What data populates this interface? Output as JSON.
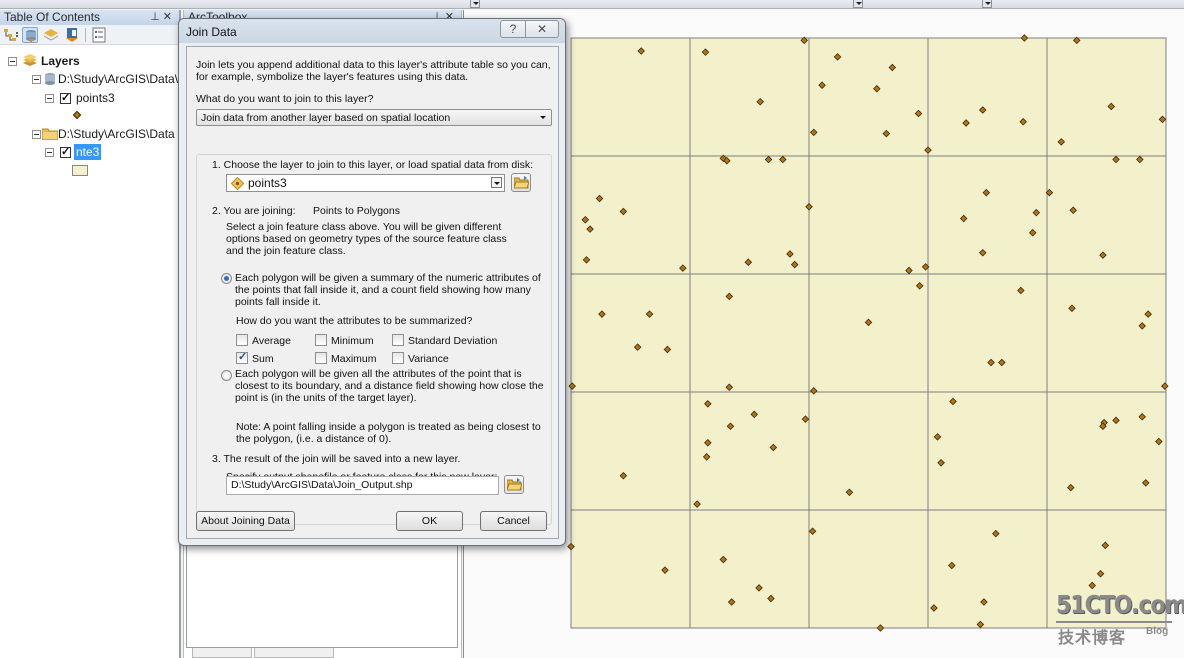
{
  "toolbar": {
    "dropdowns": [
      "toolbar-dropdown-1",
      "toolbar-dropdown-2",
      "toolbar-dropdown-3"
    ]
  },
  "toc": {
    "title": "Table Of Contents",
    "pin_icon": "pin-icon",
    "close_icon": "close-icon",
    "tools": [
      "list-by-drawing-order",
      "list-by-source",
      "list-by-visibility",
      "list-by-selection",
      "options"
    ],
    "tree": {
      "root_label": "Layers",
      "groups": [
        {
          "path": "D:\\Study\\ArcGIS\\Data\\",
          "icon": "database-icon",
          "layer": {
            "name": "points3",
            "checked": true,
            "selected": false,
            "symbol": "point"
          }
        },
        {
          "path": "D:\\Study\\ArcGIS\\Data",
          "icon": "folder-icon",
          "layer": {
            "name": "nte3",
            "checked": true,
            "selected": true,
            "symbol": "polygon"
          }
        }
      ]
    }
  },
  "toolbox": {
    "title": "ArcToolbox"
  },
  "dialog": {
    "title": "Join Data",
    "help_label": "?",
    "close_label": "✕",
    "intro_lines": [
      "Join lets you append additional data to this layer's attribute table so you can,",
      "for example, symbolize the layer's features using this data."
    ],
    "question": "What do you want to join to this layer?",
    "join_type_selected": "Join data from another layer based on spatial location",
    "step1_label": "1.  Choose the layer to join to this layer, or load spatial data from disk:",
    "layer_selected": "points3",
    "step2_label": "2.  You are joining:",
    "step2_value": "Points to Polygons",
    "step2_desc": [
      "Select a join feature class above.  You will be given different",
      "options based on geometry types of the source feature class",
      "and the join feature class."
    ],
    "option_summary": {
      "selected": true,
      "lines": [
        "Each polygon will be given a summary of the numeric attributes of",
        "the points that fall inside it, and a count field showing how many",
        "points fall inside it."
      ]
    },
    "summarize_question": "How do you want the attributes to be summarized?",
    "summaries": [
      {
        "label": "Average",
        "checked": false
      },
      {
        "label": "Minimum",
        "checked": false
      },
      {
        "label": "Standard Deviation",
        "checked": false
      },
      {
        "label": "Sum",
        "checked": true
      },
      {
        "label": "Maximum",
        "checked": false
      },
      {
        "label": "Variance",
        "checked": false
      }
    ],
    "option_closest": {
      "selected": false,
      "lines": [
        "Each polygon will be given all the attributes of the point that is",
        "closest to its boundary, and a distance field showing how close the",
        "point is (in the units of the target layer)."
      ]
    },
    "note_lines": [
      "Note: A point falling inside a polygon is treated as being closest to",
      "the polygon, (i.e. a distance of 0)."
    ],
    "step3_label": "3.  The result of the join will be saved into a new layer.",
    "step3_desc": "Specify output shapefile or feature class for this new layer:",
    "output_path": "D:\\Study\\ArcGIS\\Data\\Join_Output.shp",
    "about_button": "About Joining Data",
    "ok_button": "OK",
    "cancel_button": "Cancel"
  },
  "map": {
    "grid": {
      "columns": 5,
      "rows": 5
    },
    "colors": {
      "polygon_fill": "#f3f0cc",
      "polygon_stroke": "#7f7f7f",
      "point_fill": "#b8730d",
      "point_stroke": "#3a2a10"
    },
    "points": [
      [
        0.59,
        0.11
      ],
      [
        1.13,
        0.12
      ],
      [
        1.96,
        0.02
      ],
      [
        2.24,
        0.16
      ],
      [
        2.11,
        0.4
      ],
      [
        1.59,
        0.54
      ],
      [
        2.04,
        0.8
      ],
      [
        1.28,
        1.02
      ],
      [
        1.31,
        1.04
      ],
      [
        1.66,
        1.03
      ],
      [
        1.78,
        1.03
      ],
      [
        0.24,
        1.36
      ],
      [
        0.44,
        1.47
      ],
      [
        0.12,
        1.54
      ],
      [
        0.16,
        1.62
      ],
      [
        2.0,
        1.43
      ],
      [
        1.84,
        1.83
      ],
      [
        1.49,
        1.9
      ],
      [
        1.88,
        1.92
      ],
      [
        0.13,
        1.88
      ],
      [
        0.94,
        1.95
      ],
      [
        2.7,
        0.25
      ],
      [
        2.57,
        0.43
      ],
      [
        2.92,
        0.64
      ],
      [
        2.65,
        0.81
      ],
      [
        3.0,
        0.95
      ],
      [
        3.81,
        0.0
      ],
      [
        4.25,
        0.02
      ],
      [
        3.46,
        0.61
      ],
      [
        3.32,
        0.72
      ],
      [
        3.8,
        0.71
      ],
      [
        4.54,
        0.58
      ],
      [
        4.97,
        0.69
      ],
      [
        4.12,
        0.88
      ],
      [
        4.58,
        1.03
      ],
      [
        4.78,
        1.03
      ],
      [
        3.49,
        1.31
      ],
      [
        4.02,
        1.31
      ],
      [
        3.3,
        1.53
      ],
      [
        3.91,
        1.48
      ],
      [
        3.88,
        1.65
      ],
      [
        4.22,
        1.46
      ],
      [
        3.46,
        1.82
      ],
      [
        4.47,
        1.84
      ],
      [
        2.84,
        1.97
      ],
      [
        2.98,
        1.94
      ],
      [
        0.26,
        2.34
      ],
      [
        0.66,
        2.34
      ],
      [
        0.56,
        2.62
      ],
      [
        0.81,
        2.64
      ],
      [
        0.01,
        2.95
      ],
      [
        1.33,
        2.19
      ],
      [
        1.33,
        2.96
      ],
      [
        2.04,
        2.99
      ],
      [
        1.15,
        3.1
      ],
      [
        1.54,
        3.19
      ],
      [
        1.97,
        3.23
      ],
      [
        1.34,
        3.29
      ],
      [
        1.15,
        3.43
      ],
      [
        1.14,
        3.55
      ],
      [
        1.7,
        3.47
      ],
      [
        0.44,
        3.71
      ],
      [
        1.06,
        3.95
      ],
      [
        2.34,
        3.85
      ],
      [
        2.93,
        2.1
      ],
      [
        2.5,
        2.41
      ],
      [
        3.78,
        2.14
      ],
      [
        3.53,
        2.75
      ],
      [
        3.62,
        2.75
      ],
      [
        4.21,
        2.29
      ],
      [
        4.85,
        2.34
      ],
      [
        4.8,
        2.44
      ],
      [
        4.99,
        2.95
      ],
      [
        3.21,
        3.08
      ],
      [
        3.08,
        3.38
      ],
      [
        3.11,
        3.6
      ],
      [
        4.48,
        3.26
      ],
      [
        4.47,
        3.29
      ],
      [
        4.58,
        3.24
      ],
      [
        4.8,
        3.21
      ],
      [
        4.94,
        3.42
      ],
      [
        4.2,
        3.81
      ],
      [
        4.83,
        3.77
      ],
      [
        0.0,
        4.31
      ],
      [
        0.79,
        4.51
      ],
      [
        1.28,
        4.42
      ],
      [
        1.58,
        4.66
      ],
      [
        1.35,
        4.78
      ],
      [
        1.68,
        4.75
      ],
      [
        2.03,
        4.18
      ],
      [
        2.6,
        5.0
      ],
      [
        3.57,
        4.2
      ],
      [
        3.2,
        4.47
      ],
      [
        3.05,
        4.83
      ],
      [
        3.47,
        4.78
      ],
      [
        3.44,
        4.97
      ],
      [
        4.49,
        4.3
      ],
      [
        4.45,
        4.54
      ],
      [
        4.38,
        4.64
      ]
    ]
  },
  "watermark": {
    "brand": "51CTO.com",
    "subtitle": "技术博客",
    "blog": "Blog"
  }
}
